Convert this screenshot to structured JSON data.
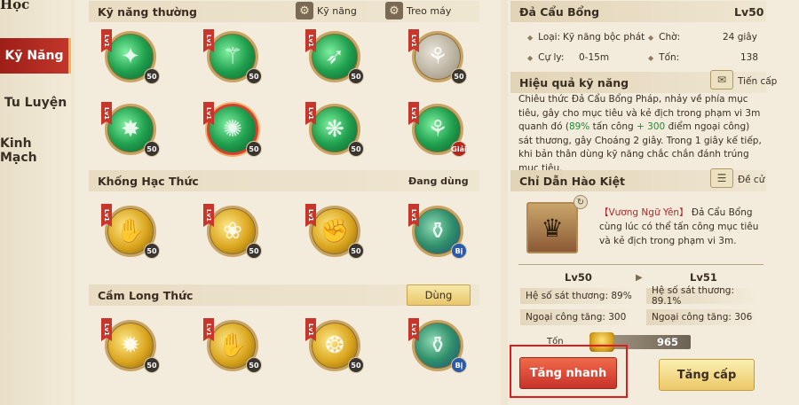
{
  "nav": {
    "title": "Học",
    "items": [
      {
        "label": "Kỹ Năng",
        "active": true
      },
      {
        "label": "Tu Luyện",
        "active": false
      },
      {
        "label": "Kinh Mạch",
        "active": false
      }
    ]
  },
  "sections": {
    "normal": {
      "title": "Kỹ năng thường",
      "skill_btn": "Kỹ năng",
      "auto_btn": "Treo máy"
    },
    "khong_hac": {
      "title": "Khống Hạc Thức",
      "status": "Đang dùng"
    },
    "cam_long": {
      "title": "Cầm Long Thức",
      "use_btn": "Dùng"
    }
  },
  "skills": {
    "row1": [
      {
        "level": "Lv1",
        "badge": "50",
        "color": "green",
        "icon": "claw-icon"
      },
      {
        "level": "Lv1",
        "badge": "50",
        "color": "green",
        "icon": "staff-icon"
      },
      {
        "level": "Lv1",
        "badge": "50",
        "color": "green",
        "icon": "spear-icon"
      },
      {
        "level": "Lv1",
        "badge": "50",
        "color": "gray",
        "icon": "bamboo-icon"
      }
    ],
    "row2": [
      {
        "level": "Lv1",
        "badge": "50",
        "color": "green",
        "icon": "strike-icon"
      },
      {
        "level": "Lv1",
        "badge": "50",
        "color": "green",
        "icon": "staff-spin-icon",
        "selected": true
      },
      {
        "level": "Lv1",
        "badge": "50",
        "color": "green",
        "icon": "slash-icon"
      },
      {
        "level": "Lv1",
        "badge": "Giải",
        "color": "green",
        "icon": "bamboo-green-icon"
      }
    ],
    "row3": [
      {
        "level": "Lv1",
        "badge": "50",
        "color": "gold",
        "icon": "palm-icon"
      },
      {
        "level": "Lv1",
        "badge": "50",
        "color": "gold",
        "icon": "crane-icon"
      },
      {
        "level": "Lv1",
        "badge": "50",
        "color": "gold",
        "icon": "fist-icon"
      },
      {
        "level": "Lv1",
        "badge": "Bị",
        "color": "greenvase",
        "icon": "vase-icon"
      }
    ],
    "row4": [
      {
        "level": "Lv1",
        "badge": "50",
        "color": "gold",
        "icon": "burst-icon"
      },
      {
        "level": "Lv1",
        "badge": "50",
        "color": "gold",
        "icon": "hand-icon"
      },
      {
        "level": "Lv1",
        "badge": "50",
        "color": "gold",
        "icon": "dragon-icon"
      },
      {
        "level": "Lv1",
        "badge": "Bị",
        "color": "greenvase",
        "icon": "vase-icon"
      }
    ]
  },
  "detail": {
    "name": "Đả Cẩu Bổng",
    "level": "Lv50",
    "type_label": "Loại:",
    "type_value": "Kỹ năng bộc phát",
    "wait_label": "Chờ:",
    "wait_value": "24 giây",
    "range_label": "Cự ly:",
    "range_value": "0-15m",
    "cost_label": "Tốn:",
    "cost_value": "138",
    "effect_title": "Hiệu quả kỹ năng",
    "advance_label": "Tiến cấp",
    "desc_1": "Chiêu thức Đả Cẩu Bổng Pháp, nhảy về phía mục tiêu, gây cho mục tiêu và kẻ địch trong phạm vi 3m quanh đó (",
    "desc_pct": "89%",
    "desc_2": " tấn công ",
    "desc_plus": "+ 300",
    "desc_3": " điểm ngoại công) sát thương, gây Choáng 2 giây. Trong 1 giây kế tiếp, khi bản thân dùng kỹ năng chắc chắn đánh trúng mục tiêu."
  },
  "guide": {
    "title": "Chỉ Dẫn Hào Kiệt",
    "recommend_label": "Đề cử",
    "hero_name": "【Vương Ngữ Yên】",
    "hero_text": "Đả Cẩu Bổng cùng lúc có thể tấn công mục tiêu và kẻ địch trong phạm vi 3m."
  },
  "compare": {
    "current_level": "Lv50",
    "next_level": "Lv51",
    "current_dmg": "Hệ số sát thương: 89%",
    "next_dmg": "Hệ số sát thương: 89.1%",
    "current_ext": "Ngoại công tăng: 300",
    "next_ext": "Ngoại công tăng: 306"
  },
  "upgrade": {
    "cost_label": "Tốn",
    "cost_value": "965",
    "quick_btn": "Tăng nhanh",
    "level_btn": "Tăng cấp"
  }
}
